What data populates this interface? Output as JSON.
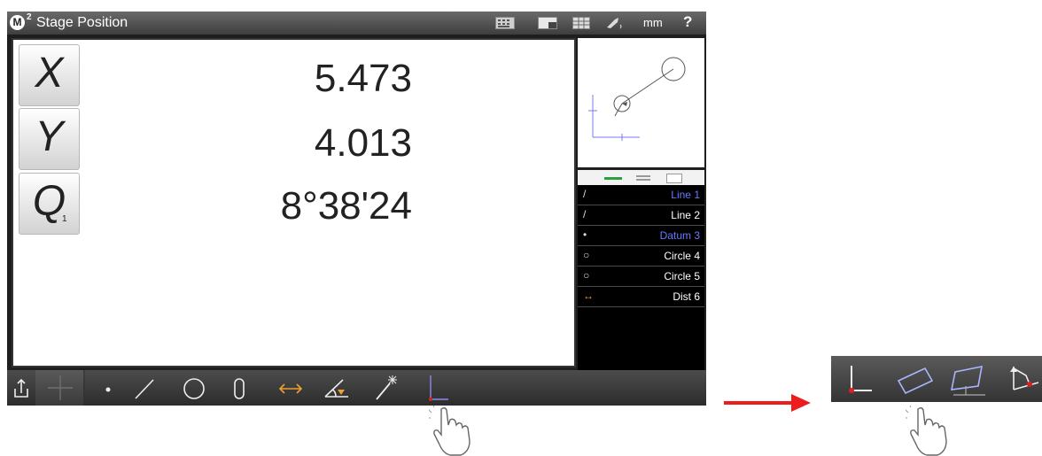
{
  "app": {
    "logo": "M",
    "logo_sup": "2",
    "title": "Stage Position",
    "units": "mm",
    "help": "?"
  },
  "readouts": [
    {
      "axis": "X",
      "sub": "",
      "value": "5.473"
    },
    {
      "axis": "Y",
      "sub": "",
      "value": "4.013"
    },
    {
      "axis": "Q",
      "sub": "1",
      "value": "8°38'24"
    }
  ],
  "features": [
    {
      "icon": "line-icon",
      "glyph": "/",
      "label": "Line 1",
      "selected": true
    },
    {
      "icon": "line-icon",
      "glyph": "/",
      "label": "Line 2",
      "selected": false
    },
    {
      "icon": "point-icon",
      "glyph": "•",
      "label": "Datum 3",
      "selected": true
    },
    {
      "icon": "circle-icon",
      "glyph": "○",
      "label": "Circle 4",
      "selected": false
    },
    {
      "icon": "circle-icon",
      "glyph": "○",
      "label": "Circle 5",
      "selected": false
    },
    {
      "icon": "distance-icon",
      "glyph": "↔",
      "label": "Dist 6",
      "selected": false
    }
  ],
  "toolbar_tools": [
    "export-icon",
    "crosshair-icon",
    "point-icon",
    "line-icon",
    "circle-icon",
    "slot-icon",
    "distance-icon",
    "angle-icon",
    "magic-wand-icon",
    "skew-icon"
  ],
  "strip_tools": [
    "skew-icon",
    "rectangle-icon",
    "plane-rectangle-icon",
    "angle-datum-icon"
  ],
  "colors": {
    "selected_feature": "#6b78ff",
    "accent_orange": "#f0a030",
    "accent_red": "#e02020",
    "arrow": "#ee1c1c"
  }
}
